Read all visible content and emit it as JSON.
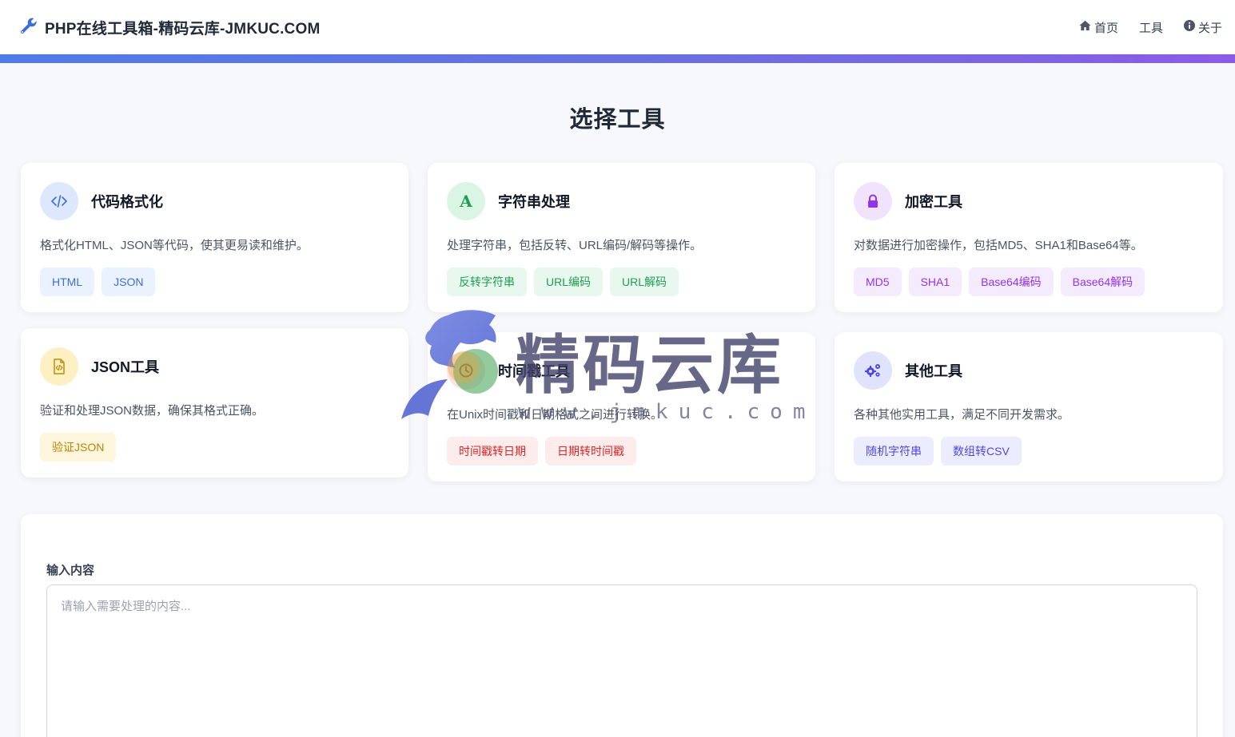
{
  "header": {
    "brand_icon": "wrench-icon",
    "brand_title": "PHP在线工具箱-精码云库-JMKUC.COM",
    "nav": [
      {
        "icon": "home-icon",
        "label": "首页"
      },
      {
        "icon": "",
        "label": "工具"
      },
      {
        "icon": "info-circle-icon",
        "label": "关于"
      }
    ]
  },
  "colors": {
    "accent_start": "#4f7be8",
    "accent_end": "#8b5be8",
    "background": "#f7f8fb"
  },
  "main": {
    "section_title": "选择工具",
    "cards": [
      {
        "icon": "code-icon",
        "title": "代码格式化",
        "description": "格式化HTML、JSON等代码，使其更易读和维护。",
        "tags": [
          "HTML",
          "JSON"
        ],
        "theme": "blue"
      },
      {
        "icon": "font-letter-a-icon",
        "title": "字符串处理",
        "description": "处理字符串，包括反转、URL编码/解码等操作。",
        "tags": [
          "反转字符串",
          "URL编码",
          "URL解码"
        ],
        "theme": "green"
      },
      {
        "icon": "lock-icon",
        "title": "加密工具",
        "description": "对数据进行加密操作，包括MD5、SHA1和Base64等。",
        "tags": [
          "MD5",
          "SHA1",
          "Base64编码",
          "Base64解码"
        ],
        "theme": "purple"
      },
      {
        "icon": "json-file-icon",
        "title": "JSON工具",
        "description": "验证和处理JSON数据，确保其格式正确。",
        "tags": [
          "验证JSON"
        ],
        "theme": "yellow"
      },
      {
        "icon": "clock-icon",
        "title": "时间戳工具",
        "description": "在Unix时间戳和日期格式之间进行转换。",
        "tags": [
          "时间戳转日期",
          "日期转时间戳"
        ],
        "theme": "red"
      },
      {
        "icon": "gears-icon",
        "title": "其他工具",
        "description": "各种其他实用工具，满足不同开发需求。",
        "tags": [
          "随机字符串",
          "数组转CSV"
        ],
        "theme": "indigo"
      }
    ]
  },
  "input": {
    "label": "输入内容",
    "placeholder": "请输入需要处理的内容...",
    "value": ""
  },
  "watermark": {
    "logo": "dragon-logo-icon",
    "text": "精码云库",
    "url": "www.jmkuc.com"
  }
}
